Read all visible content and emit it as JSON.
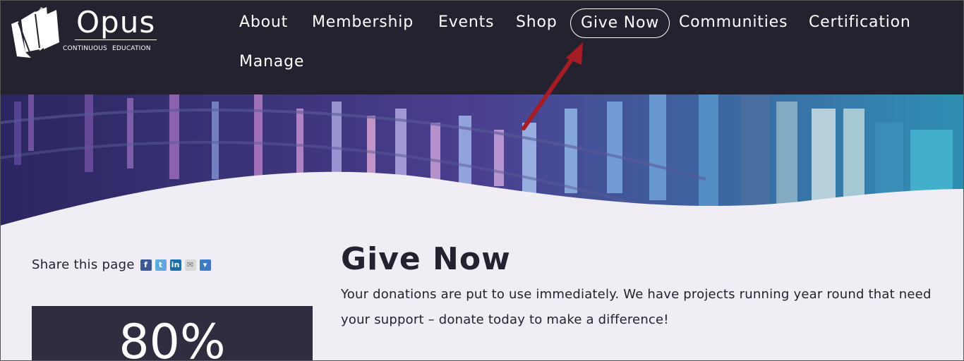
{
  "logo": {
    "name": "Opus",
    "tagline": "CONTINUOUS EDUCATION"
  },
  "nav": {
    "items": [
      {
        "label": "About"
      },
      {
        "label": "Membership"
      },
      {
        "label": "Events"
      },
      {
        "label": "Shop"
      },
      {
        "label": "Give Now",
        "active": true
      },
      {
        "label": "Communities"
      },
      {
        "label": "Certification"
      },
      {
        "label": "Manage"
      }
    ]
  },
  "share": {
    "label": "Share this page",
    "icons": [
      "facebook-icon",
      "twitter-icon",
      "linkedin-icon",
      "email-icon",
      "more-dropdown-icon"
    ]
  },
  "stat": {
    "value": "80%"
  },
  "page": {
    "title": "Give Now",
    "intro": "Your donations are put to use immediately. We have projects running year round that need your support – donate today to make a difference!"
  },
  "colors": {
    "header_bg": "#23222e",
    "page_bg": "#f0edf5",
    "stat_bg": "#2f2e40",
    "annotation_arrow": "#a51c24"
  }
}
